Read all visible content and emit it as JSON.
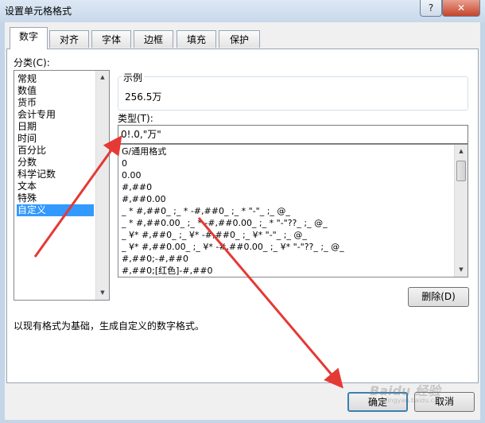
{
  "window": {
    "title": "设置单元格格式",
    "help_glyph": "?",
    "close_glyph": "✕"
  },
  "tabs": [
    "数字",
    "对齐",
    "字体",
    "边框",
    "填充",
    "保护"
  ],
  "category": {
    "label": "分类(C):",
    "items": [
      "常规",
      "数值",
      "货币",
      "会计专用",
      "日期",
      "时间",
      "百分比",
      "分数",
      "科学记数",
      "文本",
      "特殊",
      "自定义"
    ],
    "selected": "自定义"
  },
  "sample": {
    "label": "示例",
    "value": "256.5万"
  },
  "type": {
    "label": "类型(T):",
    "input_value": "0!.0,\"万\"",
    "formats": [
      "G/通用格式",
      "0",
      "0.00",
      "#,##0",
      "#,##0.00",
      "_ * #,##0_ ;_ * -#,##0_ ;_ * \"-\"_ ;_ @_",
      "_ * #,##0.00_ ;_ * -#,##0.00_ ;_ * \"-\"??_ ;_ @_",
      "_ ¥* #,##0_ ;_ ¥* -#,##0_ ;_ ¥* \"-\"_ ;_ @_",
      "_ ¥* #,##0.00_ ;_ ¥* -#,##0.00_ ;_ ¥* \"-\"??_ ;_ @_",
      "#,##0;-#,##0",
      "#,##0;[红色]-#,##0"
    ]
  },
  "delete_button": "删除(D)",
  "description": "以现有格式为基础，生成自定义的数字格式。",
  "ok_button": "确定",
  "cancel_button": "取消",
  "watermark": {
    "text": "Baidu 经验",
    "sub": "jingyan.baidu.com"
  },
  "colors": {
    "annotation_arrow": "#e53935",
    "selection": "#3399ff"
  }
}
